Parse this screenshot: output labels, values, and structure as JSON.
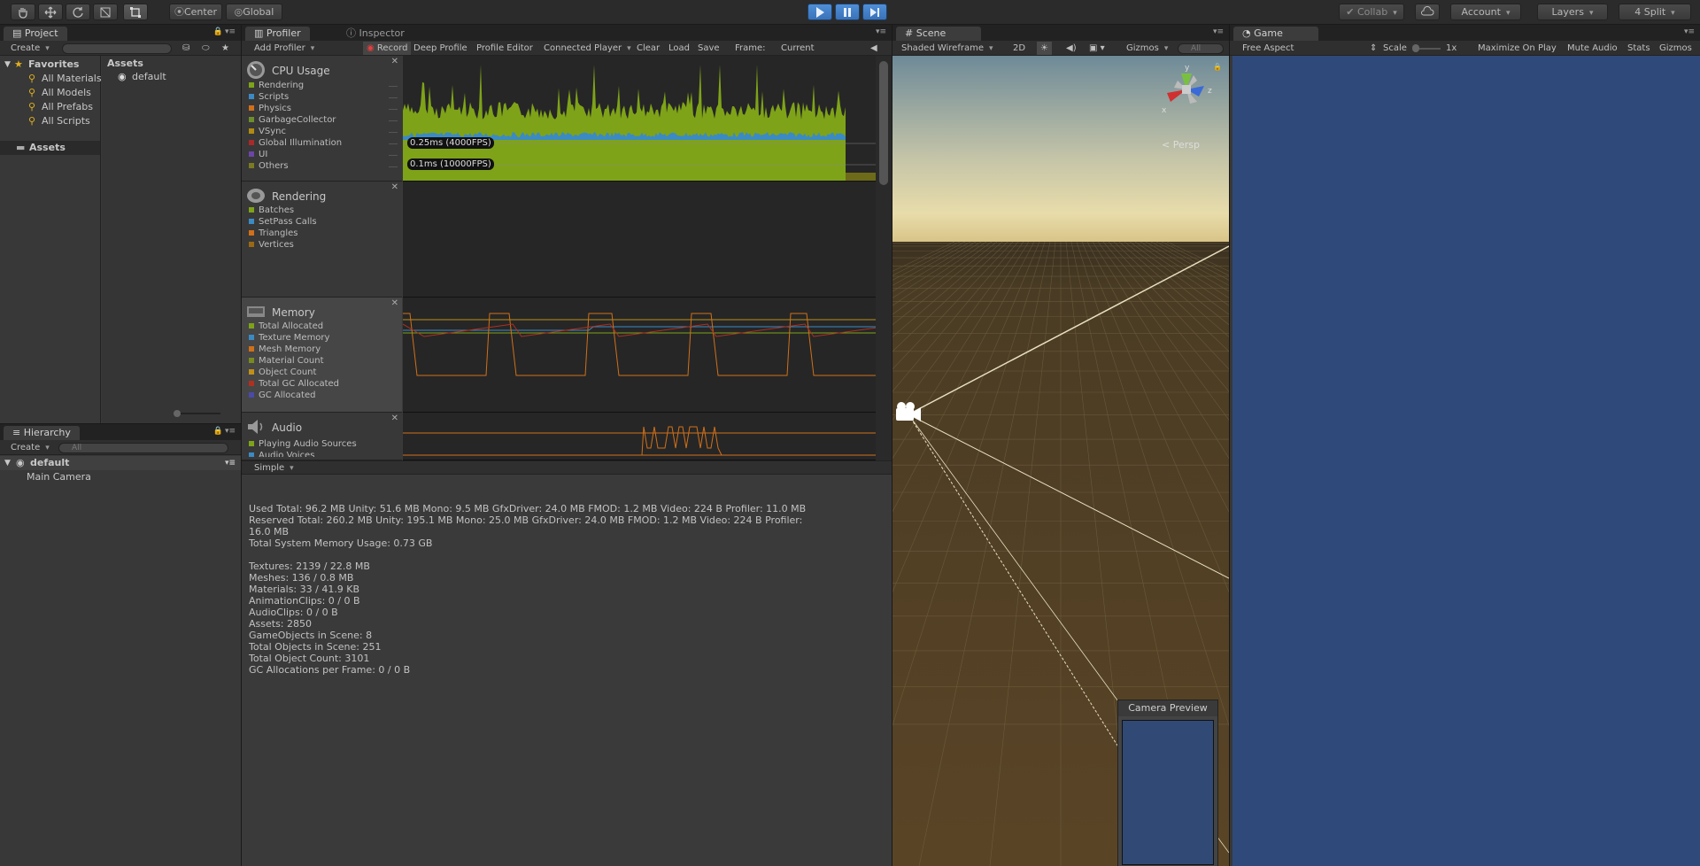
{
  "toolbar": {
    "center_label": "Center",
    "global_label": "Global",
    "collab_label": "Collab",
    "account_label": "Account",
    "layers_label": "Layers",
    "layout_label": "4 Split"
  },
  "project": {
    "tab": "Project",
    "create_label": "Create",
    "favorites_label": "Favorites",
    "favorites": [
      "All Materials",
      "All Models",
      "All Prefabs",
      "All Scripts"
    ],
    "assets_label": "Assets",
    "assets_header": "Assets",
    "asset_items": [
      "default"
    ]
  },
  "hierarchy": {
    "tab": "Hierarchy",
    "create_label": "Create",
    "search_placeholder": "All",
    "scene_name": "default",
    "objects": [
      "Main Camera"
    ]
  },
  "profiler": {
    "tab_profiler": "Profiler",
    "tab_inspector": "Inspector",
    "add_profiler": "Add Profiler",
    "record": "Record",
    "deep_profile": "Deep Profile",
    "profile_editor": "Profile Editor",
    "connected_player": "Connected Player",
    "clear": "Clear",
    "load": "Load",
    "save": "Save",
    "frame_label": "Frame:",
    "frame_value": "Current",
    "modules": [
      {
        "title": "CPU Usage",
        "legend": [
          "Rendering",
          "Scripts",
          "Physics",
          "GarbageCollector",
          "VSync",
          "Global Illumination",
          "UI",
          "Others"
        ],
        "colors": [
          "#7ea318",
          "#3b8ac4",
          "#d0701a",
          "#6e8e2c",
          "#b08a12",
          "#a82a2a",
          "#6b46a8",
          "#7a7a22"
        ]
      },
      {
        "title": "Rendering",
        "legend": [
          "Batches",
          "SetPass Calls",
          "Triangles",
          "Vertices"
        ],
        "colors": [
          "#7ea318",
          "#3b8ac4",
          "#d0701a",
          "#9a6a12"
        ]
      },
      {
        "title": "Memory",
        "legend": [
          "Total Allocated",
          "Texture Memory",
          "Mesh Memory",
          "Material Count",
          "Object Count",
          "Total GC Allocated",
          "GC Allocated"
        ],
        "colors": [
          "#7ea318",
          "#3b8ac4",
          "#d0701a",
          "#7a8a20",
          "#c09018",
          "#b03020",
          "#4a4aa8"
        ]
      },
      {
        "title": "Audio",
        "legend": [
          "Playing Audio Sources",
          "Audio Voices"
        ],
        "colors": [
          "#7ea318",
          "#3b8ac4"
        ]
      }
    ],
    "cpu_markers": [
      "0.25ms (4000FPS)",
      "0.1ms (10000FPS)"
    ],
    "view_mode": "Simple",
    "stats": [
      "Used Total: 96.2 MB   Unity: 51.6 MB   Mono: 9.5 MB   GfxDriver: 24.0 MB   FMOD: 1.2 MB   Video: 224 B   Profiler: 11.0 MB",
      "Reserved Total: 260.2 MB   Unity: 195.1 MB   Mono: 25.0 MB   GfxDriver: 24.0 MB   FMOD: 1.2 MB   Video: 224 B   Profiler:",
      "16.0 MB",
      "Total System Memory Usage: 0.73 GB",
      "",
      "Textures: 2139 / 22.8 MB",
      "Meshes: 136 / 0.8 MB",
      "Materials: 33 / 41.9 KB",
      "AnimationClips: 0 / 0 B",
      "AudioClips: 0 / 0 B",
      "Assets: 2850",
      "GameObjects in Scene: 8",
      "Total Objects in Scene: 251",
      "Total Object Count: 3101",
      "GC Allocations per Frame: 0 / 0 B"
    ]
  },
  "scene": {
    "tab": "Scene",
    "shading": "Shaded Wireframe",
    "mode_2d": "2D",
    "gizmos": "Gizmos",
    "search_placeholder": "All",
    "persp_label": "Persp",
    "camera_preview": "Camera Preview"
  },
  "game": {
    "tab": "Game",
    "aspect": "Free Aspect",
    "scale_label": "Scale",
    "scale_value": "1x",
    "maximize": "Maximize On Play",
    "mute": "Mute Audio",
    "stats": "Stats",
    "gizmos": "Gizmos"
  },
  "colors": {
    "play_blue": "#3a72b8",
    "game_bg": "#2f4a7a",
    "cpu_green": "#7ea318"
  }
}
